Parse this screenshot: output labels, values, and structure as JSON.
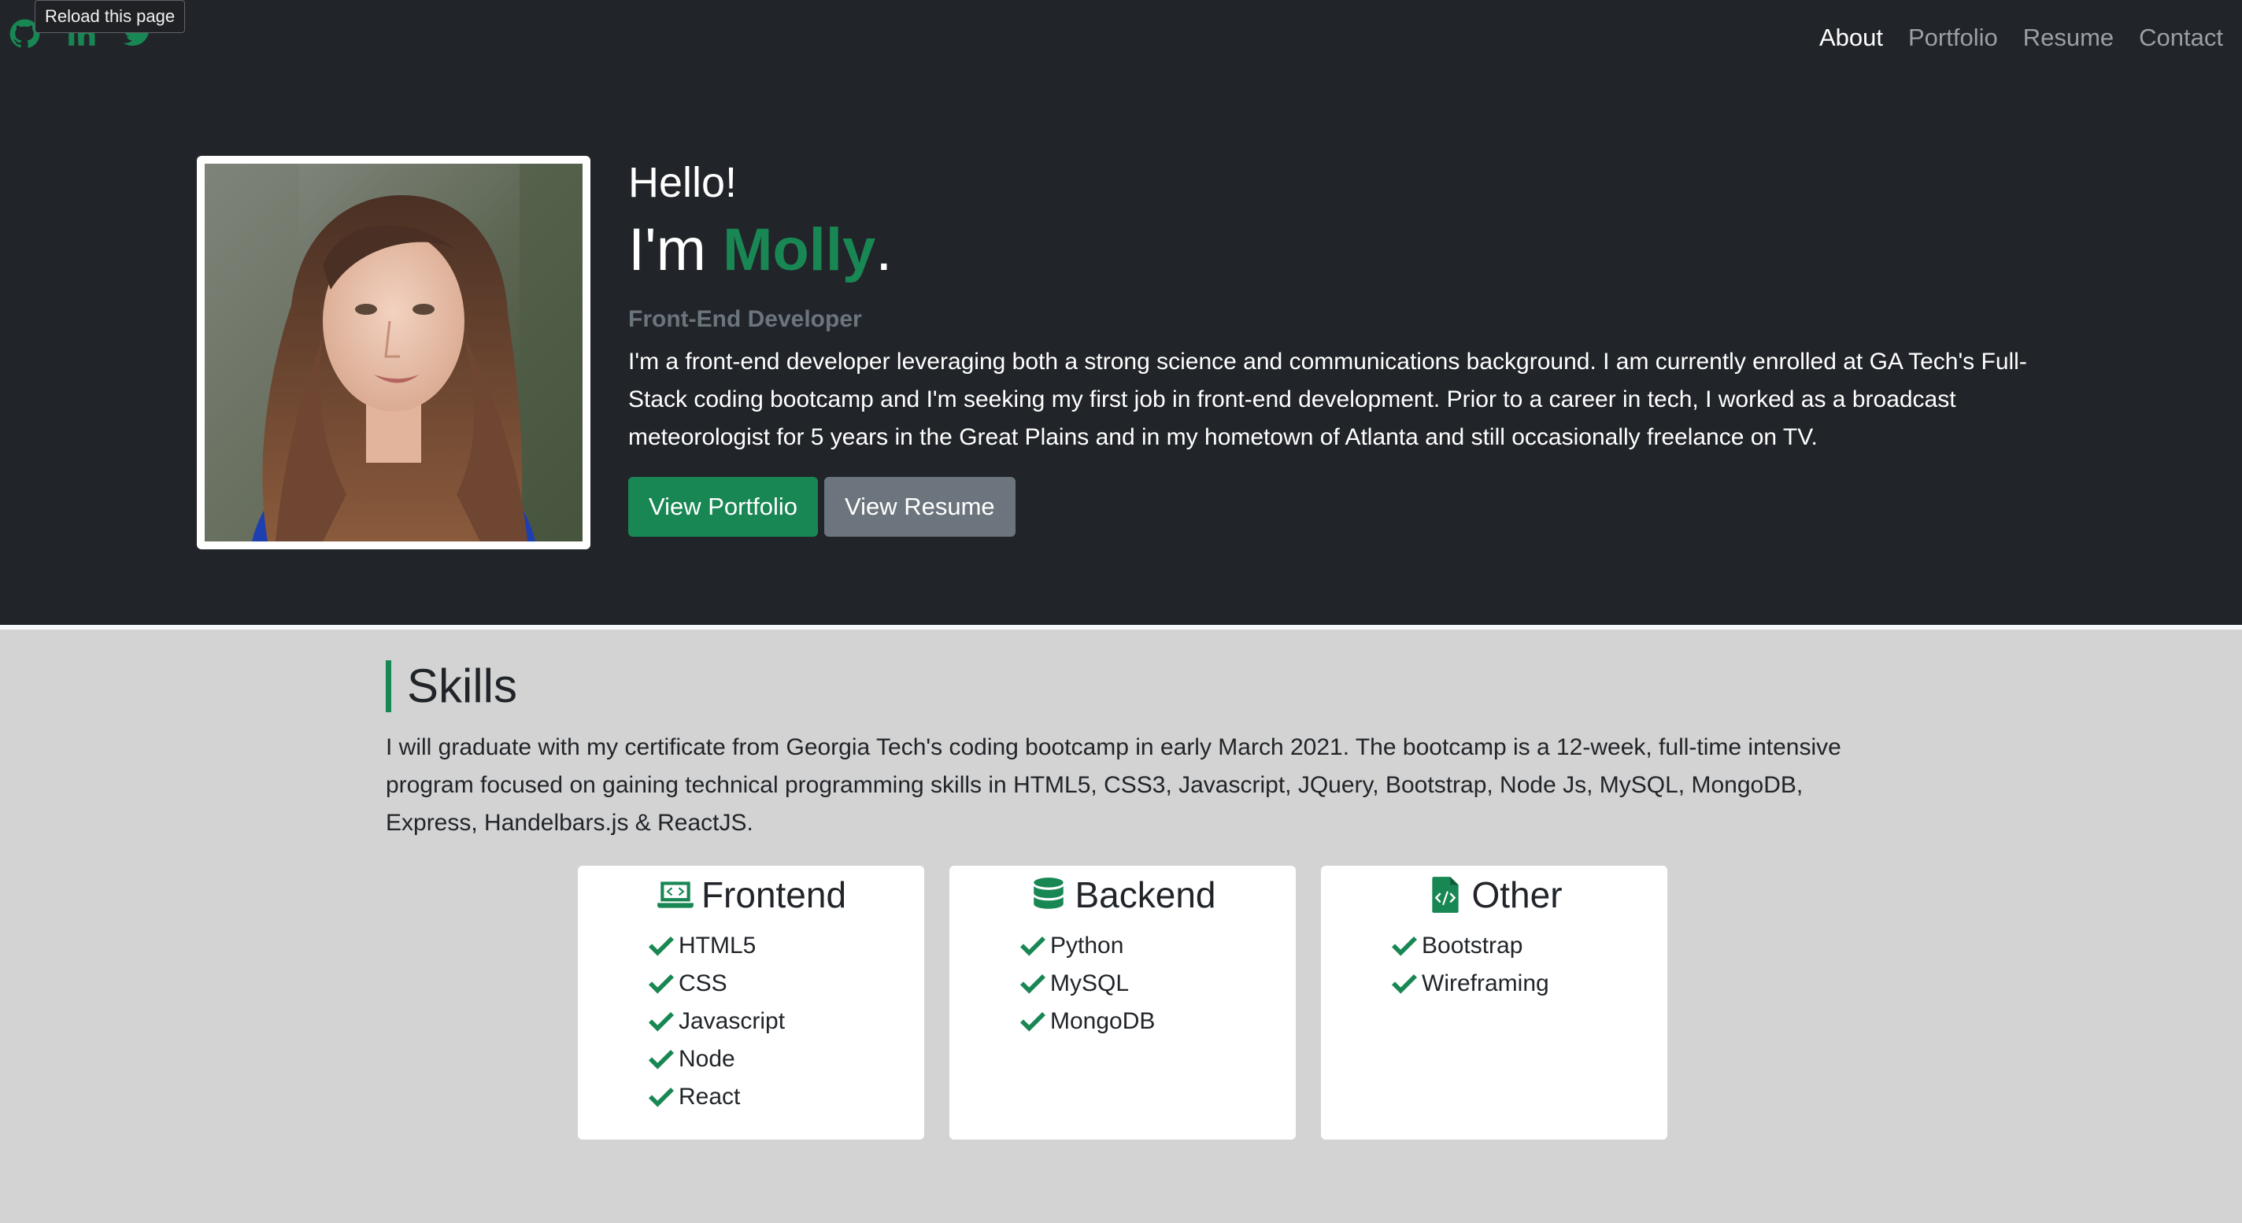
{
  "browser": {
    "tooltip": "Reload this page"
  },
  "social": [
    {
      "name": "github-icon"
    },
    {
      "name": "linkedin-icon"
    },
    {
      "name": "twitter-icon"
    }
  ],
  "nav": {
    "about": "About",
    "portfolio": "Portfolio",
    "resume": "Resume",
    "contact": "Contact"
  },
  "hero": {
    "hello": "Hello!",
    "im_prefix": "I'm ",
    "name": "Molly",
    "name_suffix": ".",
    "role": "Front-End Developer",
    "bio": "I'm a front-end developer leveraging both a strong science and communications background. I am currently enrolled at GA Tech's Full-Stack coding bootcamp and I'm seeking my first job in front-end development. Prior to a career in tech, I worked as a broadcast meteorologist for 5 years in the Great Plains and in my hometown of Atlanta and still occasionally freelance on TV.",
    "view_portfolio": "View Portfolio",
    "view_resume": "View Resume"
  },
  "skills": {
    "title": "Skills",
    "text": "I will graduate with my certificate from Georgia Tech's coding bootcamp in early March 2021. The bootcamp is a 12-week, full-time intensive program focused on gaining technical programming skills in HTML5, CSS3, Javascript, JQuery, Bootstrap, Node Js, MySQL, MongoDB, Express, Handelbars.js & ReactJS.",
    "cards": [
      {
        "title": "Frontend",
        "icon": "laptop-code-icon",
        "items": [
          "HTML5",
          "CSS",
          "Javascript",
          "Node",
          "React"
        ]
      },
      {
        "title": "Backend",
        "icon": "database-icon",
        "items": [
          "Python",
          "MySQL",
          "MongoDB"
        ]
      },
      {
        "title": "Other",
        "icon": "file-code-icon",
        "items": [
          "Bootstrap",
          "Wireframing"
        ]
      }
    ]
  },
  "colors": {
    "accent": "#198754",
    "hero_bg": "#212529",
    "page_bg": "#d3d3d3",
    "muted": "#6c757d"
  }
}
